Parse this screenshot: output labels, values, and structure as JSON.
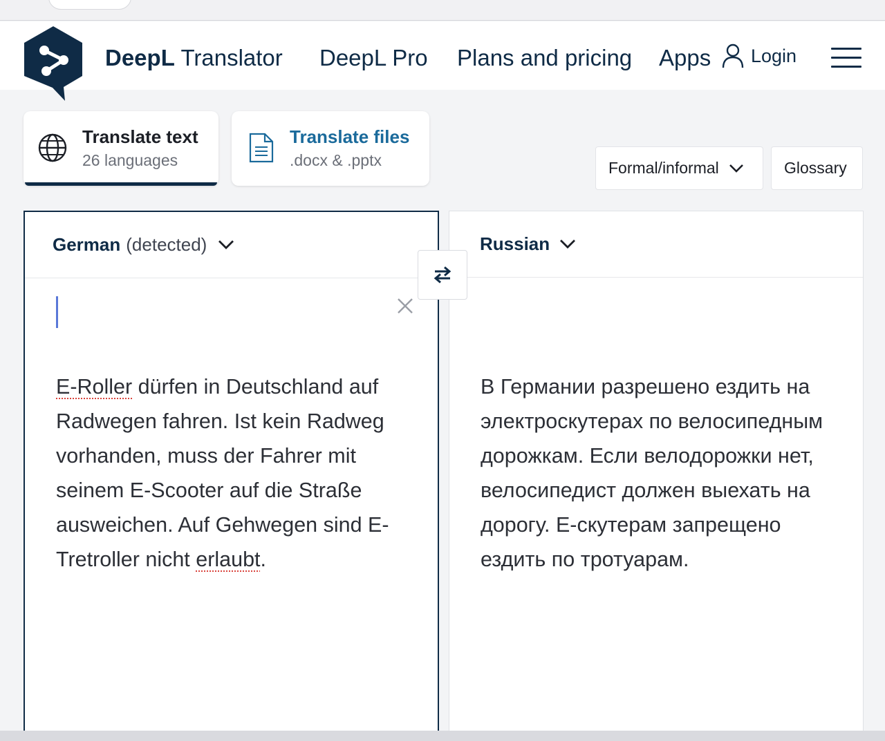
{
  "header": {
    "brand_name": "DeepL",
    "brand_suffix": "Translator",
    "nav": [
      "DeepL Pro",
      "Plans and pricing",
      "Apps"
    ],
    "login_label": "Login",
    "icons": [
      "deepl-logo-icon",
      "user-icon",
      "hamburger-menu-icon"
    ]
  },
  "tabs": [
    {
      "title": "Translate text",
      "subtitle": "26 languages",
      "icon": "globe-icon",
      "active": true
    },
    {
      "title": "Translate files",
      "subtitle": ".docx & .pptx",
      "icon": "document-icon",
      "active": false
    }
  ],
  "options": {
    "formality_label": "Formal/informal",
    "glossary_label": "Glossary"
  },
  "source": {
    "language": "German",
    "detected_note": "(detected)",
    "text_parts": [
      {
        "text": "E-Roller",
        "misspelled": true
      },
      {
        "text": " dürfen in Deutschland auf Radwegen fahren. Ist kein Radweg vorhanden, muss der Fahrer mit seinem E-Scooter auf die Straße ausweichen. Auf Gehwegen sind E-Tretroller nicht ",
        "misspelled": false
      },
      {
        "text": "erlaubt",
        "misspelled": true
      },
      {
        "text": ".",
        "misspelled": false
      }
    ]
  },
  "target": {
    "language": "Russian",
    "text": "В Германии разрешено ездить на электроскутерах по велосипедным дорожкам. Если велодорожки нет, велосипедист должен выехать на дорогу. Е-скутерам запрещено ездить по тротуарам."
  },
  "colors": {
    "brand_navy": "#0f2b46",
    "files_tab_title": "#1a6a9b",
    "caret": "#5a78d8",
    "spellcheck_underline": "#d9413a"
  }
}
